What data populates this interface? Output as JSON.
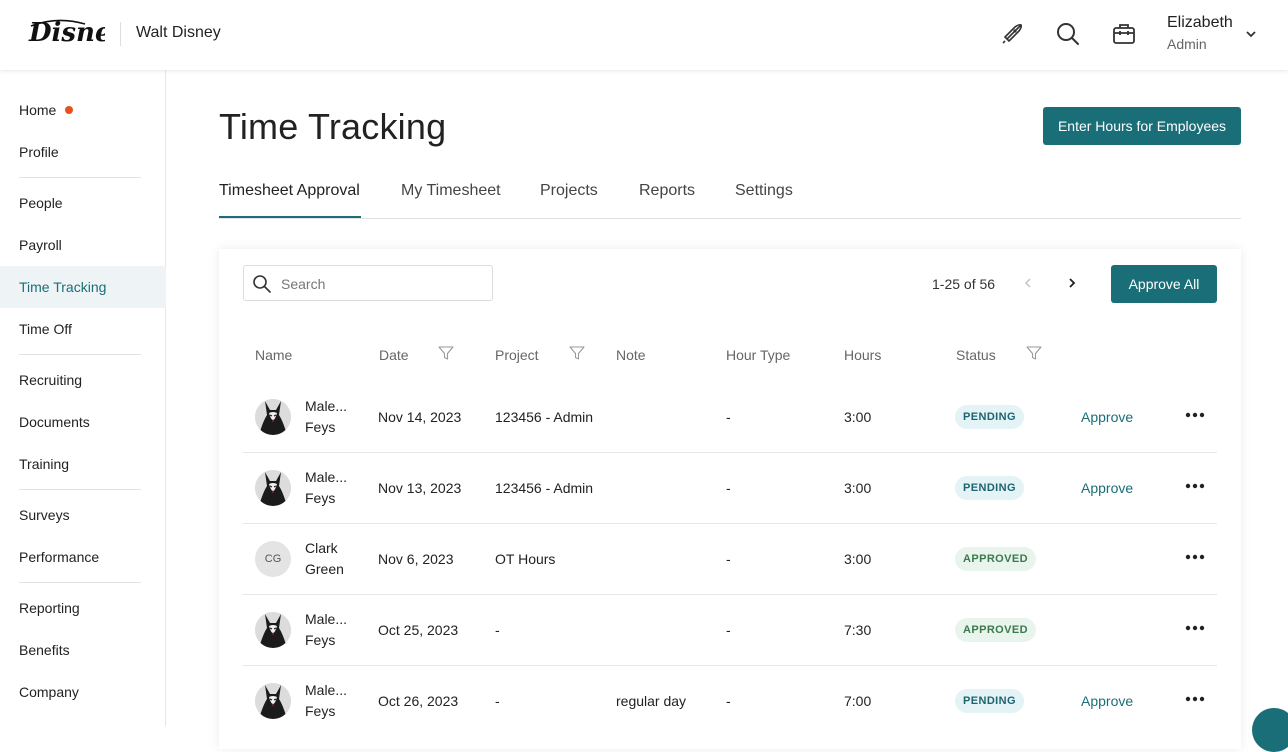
{
  "header": {
    "brand": "Disney",
    "company": "Walt Disney",
    "user_name": "Elizabeth",
    "user_role": "Admin",
    "icons": [
      "rocket-icon",
      "search-icon",
      "briefcase-icon",
      "chevron-down-icon"
    ]
  },
  "sidebar": {
    "items": [
      {
        "label": "Home",
        "has_dot": true
      },
      {
        "label": "Profile"
      },
      {
        "label": "People"
      },
      {
        "label": "Payroll"
      },
      {
        "label": "Time Tracking",
        "active": true
      },
      {
        "label": "Time Off"
      },
      {
        "label": "Recruiting"
      },
      {
        "label": "Documents"
      },
      {
        "label": "Training"
      },
      {
        "label": "Surveys"
      },
      {
        "label": "Performance"
      },
      {
        "label": "Reporting"
      },
      {
        "label": "Benefits"
      },
      {
        "label": "Company"
      }
    ]
  },
  "page": {
    "title": "Time Tracking",
    "enter_hours_button": "Enter Hours for Employees"
  },
  "tabs": [
    {
      "label": "Timesheet Approval",
      "active": true
    },
    {
      "label": "My Timesheet"
    },
    {
      "label": "Projects"
    },
    {
      "label": "Reports"
    },
    {
      "label": "Settings"
    }
  ],
  "toolbar": {
    "search_placeholder": "Search",
    "range": "1-25 of 56",
    "approve_all": "Approve All"
  },
  "table": {
    "columns": [
      "Name",
      "Date",
      "Project",
      "Note",
      "Hour Type",
      "Hours",
      "Status"
    ],
    "rows": [
      {
        "name1": "Male...",
        "name2": "Feys",
        "avatar": "portrait",
        "date": "Nov 14, 2023",
        "project": "123456 - Admin",
        "note": "",
        "hour_type": "-",
        "hours": "3:00",
        "status": "PENDING",
        "action": "Approve"
      },
      {
        "name1": "Male...",
        "name2": "Feys",
        "avatar": "portrait",
        "date": "Nov 13, 2023",
        "project": "123456 - Admin",
        "note": "",
        "hour_type": "-",
        "hours": "3:00",
        "status": "PENDING",
        "action": "Approve"
      },
      {
        "name1": "Clark",
        "name2": "Green",
        "avatar": "initials",
        "initials": "CG",
        "date": "Nov 6, 2023",
        "project": "OT Hours",
        "note": "",
        "hour_type": "-",
        "hours": "3:00",
        "status": "APPROVED",
        "action": ""
      },
      {
        "name1": "Male...",
        "name2": "Feys",
        "avatar": "portrait",
        "date": "Oct 25, 2023",
        "project": "-",
        "note": "",
        "hour_type": "-",
        "hours": "7:30",
        "status": "APPROVED",
        "action": ""
      },
      {
        "name1": "Male...",
        "name2": "Feys",
        "avatar": "portrait",
        "date": "Oct 26, 2023",
        "project": "-",
        "note": "regular day",
        "hour_type": "-",
        "hours": "7:00",
        "status": "PENDING",
        "action": "Approve"
      }
    ]
  },
  "colors": {
    "accent": "#1a6e78",
    "notification_dot": "#e8501e",
    "pending_bg": "#e3f3f6",
    "approved_bg": "#e9f4ec"
  }
}
